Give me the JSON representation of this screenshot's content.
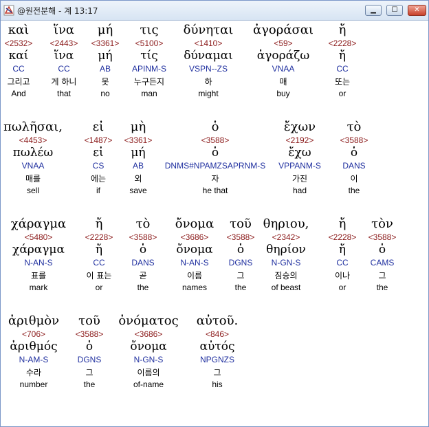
{
  "window": {
    "title": "@원전분해 - 계 13:17",
    "icon": "app-logo-icon"
  },
  "controls": {
    "minimize": "▁",
    "maximize": "☐",
    "close": "✕"
  },
  "rows": [
    [
      {
        "greek": "καὶ",
        "strong": "<2532>",
        "lemma": "καί",
        "parse": "CC",
        "korean": "그리고",
        "english": "And"
      },
      {
        "greek": "ἵνα",
        "strong": "<2443>",
        "lemma": "ἵνα",
        "parse": "CC",
        "korean": "게 하니",
        "english": "that"
      },
      {
        "greek": "μή",
        "strong": "<3361>",
        "lemma": "μή",
        "parse": "AB",
        "korean": "못",
        "english": "no"
      },
      {
        "greek": "τις",
        "strong": "<5100>",
        "lemma": "τίς",
        "parse": "APINM-S",
        "korean": "누구든지",
        "english": "man"
      },
      {
        "greek": "δύνηται",
        "strong": "<1410>",
        "lemma": "δύναμαι",
        "parse": "VSPN--ZS",
        "korean": "하",
        "english": "might"
      },
      {
        "greek": "ἀγοράσαι",
        "strong": "<59>",
        "lemma": "ἀγοράζω",
        "parse": "VNAA",
        "korean": "매",
        "english": "buy"
      },
      {
        "greek": "ἤ",
        "strong": "<2228>",
        "lemma": "ἤ",
        "parse": "CC",
        "korean": "또는",
        "english": "or"
      }
    ],
    [
      {
        "greek": "πωλῆσαι,",
        "strong": "<4453>",
        "lemma": "πωλέω",
        "parse": "VNAA",
        "korean": "매를",
        "english": "sell"
      },
      {
        "greek": "εἰ",
        "strong": "<1487>",
        "lemma": "εἰ",
        "parse": "CS",
        "korean": "에는",
        "english": "if"
      },
      {
        "greek": "μὴ",
        "strong": "<3361>",
        "lemma": "μή",
        "parse": "AB",
        "korean": "외",
        "english": "save"
      },
      {
        "greek": "ὁ",
        "strong": "<3588>",
        "lemma": "ὁ",
        "parse": "DNMS#NPAMZSAPRNM-S",
        "korean": "자",
        "english": "he that"
      },
      {
        "greek": "ἔχων",
        "strong": "<2192>",
        "lemma": "ἔχω",
        "parse": "VPPANM-S",
        "korean": "가진",
        "english": "had"
      },
      {
        "greek": "τὸ",
        "strong": "<3588>",
        "lemma": "ὁ",
        "parse": "DANS",
        "korean": "이",
        "english": "the"
      }
    ],
    [
      {
        "greek": "χάραγμα",
        "strong": "<5480>",
        "lemma": "χάραγμα",
        "parse": "N-AN-S",
        "korean": "표를",
        "english": "mark"
      },
      {
        "greek": "ἤ",
        "strong": "<2228>",
        "lemma": "ἤ",
        "parse": "CC",
        "korean": "이 표는",
        "english": "or"
      },
      {
        "greek": "τὸ",
        "strong": "<3588>",
        "lemma": "ὁ",
        "parse": "DANS",
        "korean": "곧",
        "english": "the"
      },
      {
        "greek": "ὄνομα",
        "strong": "<3686>",
        "lemma": "ὄνομα",
        "parse": "N-AN-S",
        "korean": "이름",
        "english": "names"
      },
      {
        "greek": "τοῦ",
        "strong": "<3588>",
        "lemma": "ὁ",
        "parse": "DGNS",
        "korean": "그",
        "english": "the"
      },
      {
        "greek": "θηριου,",
        "strong": "<2342>",
        "lemma": "θηρίον",
        "parse": "N-GN-S",
        "korean": "짐승의",
        "english": "of beast"
      },
      {
        "greek": "ἤ",
        "strong": "<2228>",
        "lemma": "ἤ",
        "parse": "CC",
        "korean": "이나",
        "english": "or"
      },
      {
        "greek": "τὸν",
        "strong": "<3588>",
        "lemma": "ὁ",
        "parse": "CAMS",
        "korean": "그",
        "english": "the"
      }
    ],
    [
      {
        "greek": "ἀριθμὸν",
        "strong": "<706>",
        "lemma": "ἀριθμός",
        "parse": "N-AM-S",
        "korean": "수라",
        "english": "number"
      },
      {
        "greek": "τοῦ",
        "strong": "<3588>",
        "lemma": "ὁ",
        "parse": "DGNS",
        "korean": "그",
        "english": "the"
      },
      {
        "greek": "ὀνόματος",
        "strong": "<3686>",
        "lemma": "ὄνομα",
        "parse": "N-GN-S",
        "korean": "이름의",
        "english": "of-name"
      },
      {
        "greek": "αὐτοῦ.",
        "strong": "<846>",
        "lemma": "αὐτός",
        "parse": "NPGNZS",
        "korean": "그",
        "english": "his"
      }
    ]
  ]
}
